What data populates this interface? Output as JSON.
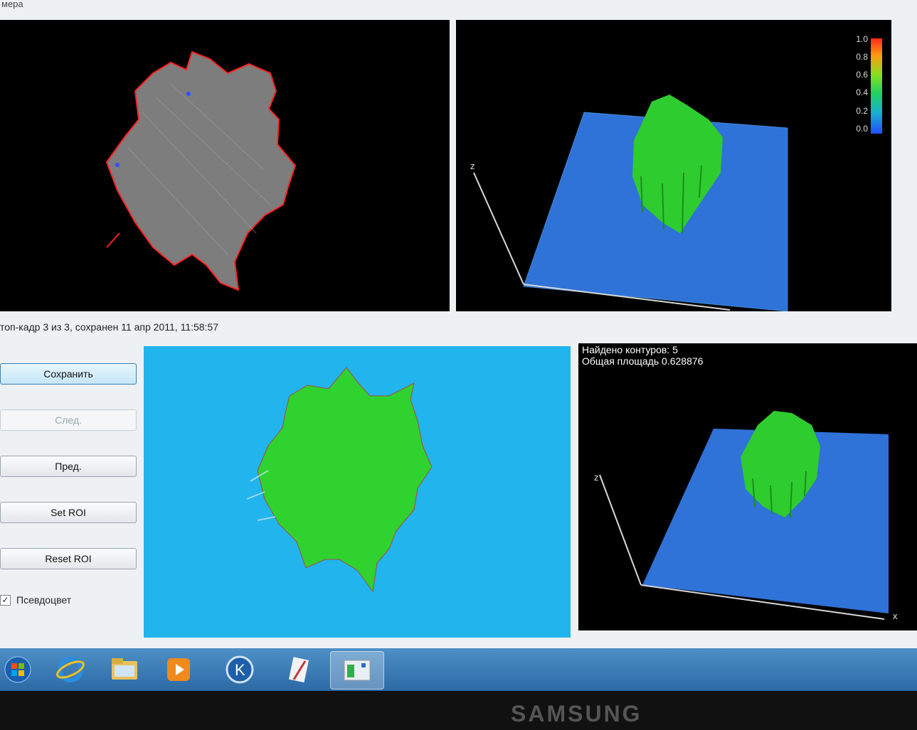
{
  "app": {
    "title": "мера",
    "status": "топ-кадр 3 из 3, сохранен 11 апр 2011, 11:58:57"
  },
  "buttons": {
    "save": "Сохранить",
    "next": "След.",
    "prev": "Пред.",
    "set_roi": "Set ROI",
    "reset_roi": "Reset ROI"
  },
  "pseudocolor": {
    "label": "Псевдоцвет",
    "checked": true
  },
  "stats": {
    "contours": "Найдено контуров: 5",
    "area": "Общая площадь 0.628876"
  },
  "legend": {
    "labels": [
      "1.0",
      "0.8",
      "0.6",
      "0.4",
      "0.2",
      "0.0"
    ]
  },
  "axes": {
    "top_z": "z",
    "bottom_z": "z",
    "bottom_x": "x"
  },
  "taskbar": {
    "items": [
      "start-orb",
      "internet-explorer",
      "file-explorer",
      "media-player",
      "kompas-app",
      "paint-app",
      "active-app"
    ]
  },
  "monitor": {
    "brand": "SAMSUNG"
  },
  "colors": {
    "cyan_bg": "#22b4ec",
    "green": "#2fd22f",
    "red_contour": "#ff2020"
  }
}
